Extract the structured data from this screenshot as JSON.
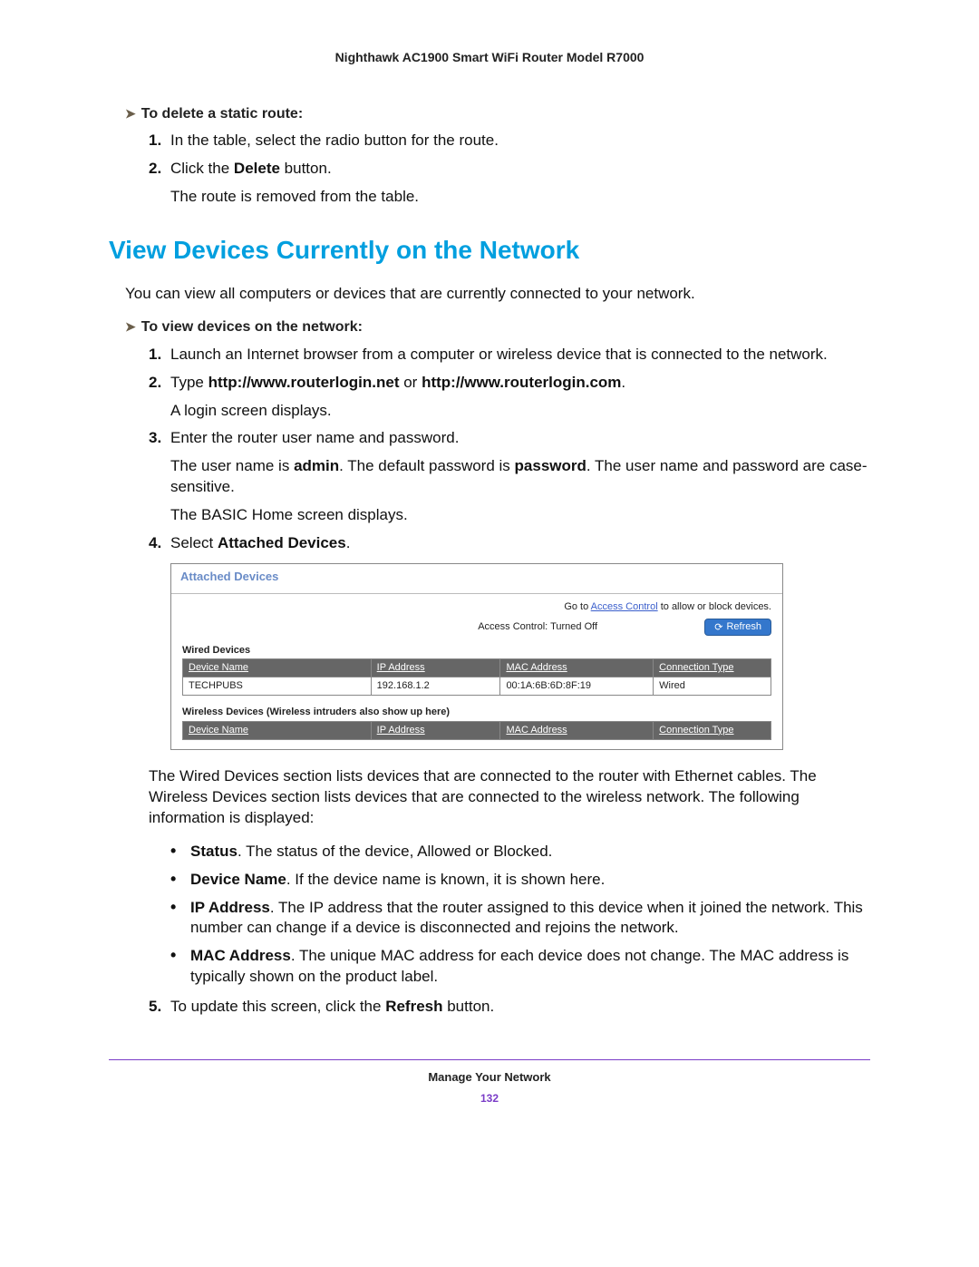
{
  "header": {
    "title": "Nighthawk AC1900 Smart WiFi Router Model R7000"
  },
  "section_delete": {
    "heading": "To delete a static route:",
    "steps": [
      {
        "num": "1.",
        "text": "In the table, select the radio button for the route."
      },
      {
        "num": "2.",
        "text_pre": "Click the ",
        "text_bold": "Delete",
        "text_post": " button.",
        "sub": "The route is removed from the table."
      }
    ]
  },
  "h1": "View Devices Currently on the Network",
  "intro": "You can view all computers or devices that are currently connected to your network.",
  "section_view": {
    "heading": "To view devices on the network:",
    "steps": {
      "s1": {
        "num": "1.",
        "text": "Launch an Internet browser from a computer or wireless device that is connected to the network."
      },
      "s2": {
        "num": "2.",
        "text_pre": "Type ",
        "bold1": "http://www.routerlogin.net",
        "mid": " or ",
        "bold2": "http://www.routerlogin.com",
        "post": ".",
        "sub": "A login screen displays."
      },
      "s3": {
        "num": "3.",
        "text": "Enter the router user name and password.",
        "sub_a_pre": "The user name is ",
        "sub_a_b1": "admin",
        "sub_a_mid": ". The default password is ",
        "sub_a_b2": "password",
        "sub_a_post": ". The user name and password are case-sensitive.",
        "sub_b": "The BASIC Home screen displays."
      },
      "s4": {
        "num": "4.",
        "text_pre": "Select ",
        "bold": "Attached Devices",
        "post": "."
      },
      "s5": {
        "num": "5.",
        "text_pre": "To update this screen, click the ",
        "bold": "Refresh",
        "post": " button."
      }
    }
  },
  "shot": {
    "title": "Attached Devices",
    "top_pre": "Go to ",
    "top_link": "Access Control",
    "top_post": " to allow or block devices.",
    "ac_status": "Access Control: Turned Off",
    "refresh": "Refresh",
    "wired_label": "Wired Devices",
    "wireless_label": "Wireless Devices (Wireless intruders also show up here)",
    "cols": {
      "name": "Device Name",
      "ip": "IP Address",
      "mac": "MAC Address",
      "conn": "Connection Type"
    },
    "wired_rows": [
      {
        "name": "TECHPUBS",
        "ip": "192.168.1.2",
        "mac": "00:1A:6B:6D:8F:19",
        "conn": "Wired"
      }
    ]
  },
  "after_shot": "The Wired Devices section lists devices that are connected to the router with Ethernet cables. The Wireless Devices section lists devices that are connected to the wireless network. The following information is displayed:",
  "bullets": {
    "b1": {
      "bold": "Status",
      "text": ". The status of the device, Allowed or Blocked."
    },
    "b2": {
      "bold": "Device Name",
      "text": ". If the device name is known, it is shown here."
    },
    "b3": {
      "bold": "IP Address",
      "text": ". The IP address that the router assigned to this device when it joined the network. This number can change if a device is disconnected and rejoins the network."
    },
    "b4": {
      "bold": "MAC Address",
      "text": ". The unique MAC address for each device does not change. The MAC address is typically shown on the product label."
    }
  },
  "footer": {
    "section": "Manage Your Network",
    "page": "132"
  }
}
